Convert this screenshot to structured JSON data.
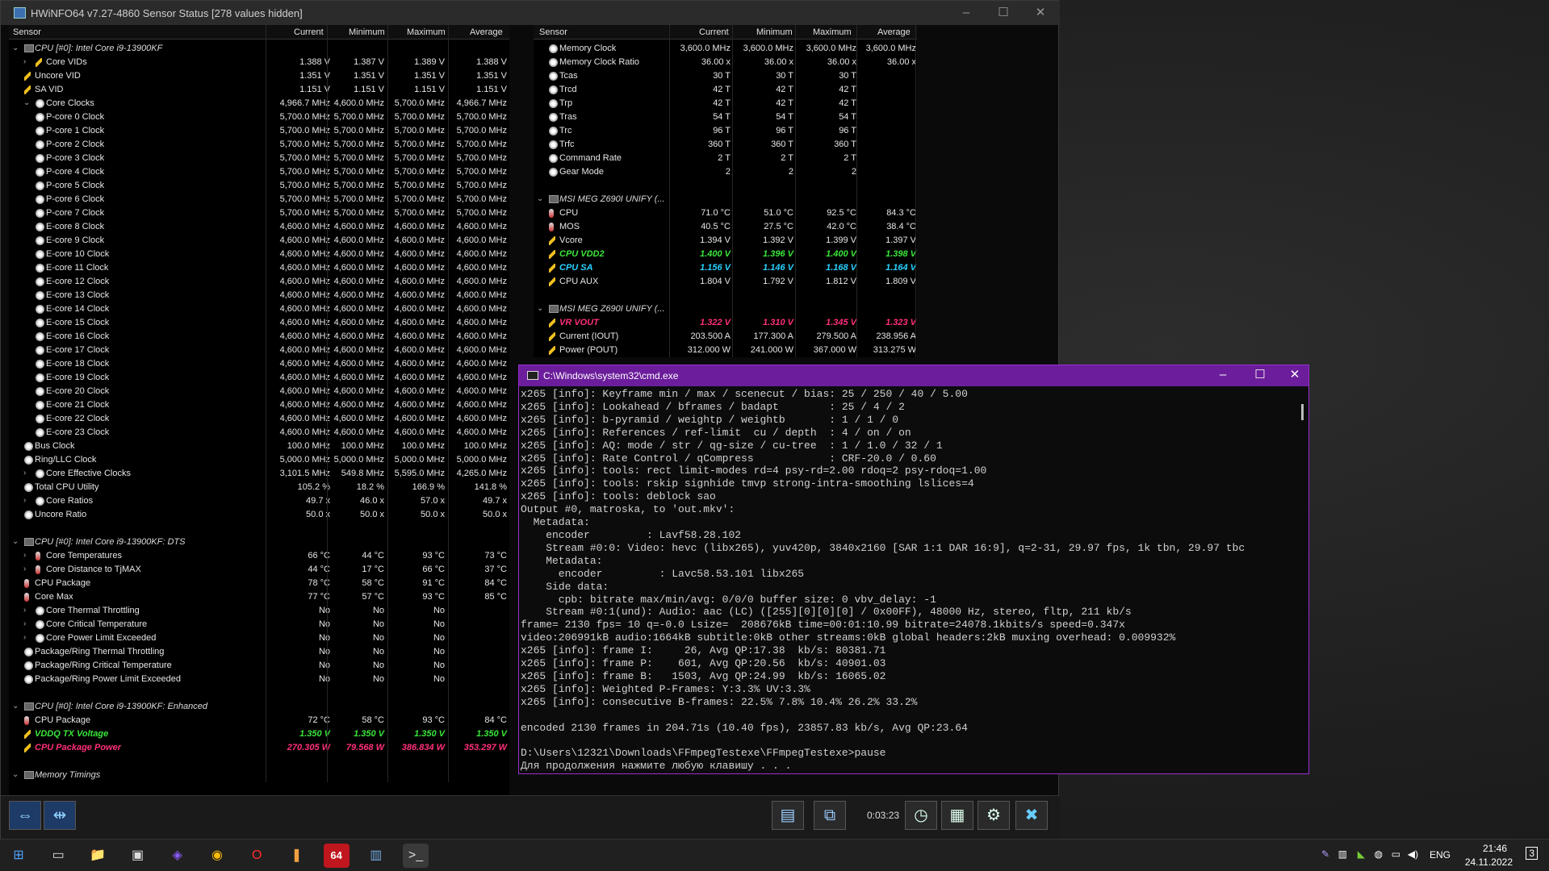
{
  "hwinfo": {
    "title": "HWiNFO64 v7.27-4860 Sensor Status [278 values hidden]",
    "columns": [
      "Sensor",
      "Current",
      "Minimum",
      "Maximum",
      "Average"
    ],
    "left_rows": [
      {
        "t": "grp",
        "exp": "v",
        "name": "CPU [#0]: Intel Core i9-13900KF",
        "cur": "",
        "min": "",
        "max": "",
        "avg": ""
      },
      {
        "t": "volt",
        "exp": ">",
        "lvl": 2,
        "name": "Core VIDs",
        "cur": "1.388 V",
        "min": "1.387 V",
        "max": "1.389 V",
        "avg": "1.388 V"
      },
      {
        "t": "volt",
        "lvl": 1,
        "name": "Uncore VID",
        "cur": "1.351 V",
        "min": "1.351 V",
        "max": "1.351 V",
        "avg": "1.351 V"
      },
      {
        "t": "volt",
        "lvl": 1,
        "name": "SA VID",
        "cur": "1.151 V",
        "min": "1.151 V",
        "max": "1.151 V",
        "avg": "1.151 V"
      },
      {
        "t": "clk",
        "exp": "v",
        "lvl": 2,
        "name": "Core Clocks",
        "cur": "4,966.7 MHz",
        "min": "4,600.0 MHz",
        "max": "5,700.0 MHz",
        "avg": "4,966.7 MHz"
      },
      {
        "t": "clk",
        "lvl": 3,
        "name": "P-core 0 Clock",
        "cur": "5,700.0 MHz",
        "min": "5,700.0 MHz",
        "max": "5,700.0 MHz",
        "avg": "5,700.0 MHz"
      },
      {
        "t": "clk",
        "lvl": 3,
        "name": "P-core 1 Clock",
        "cur": "5,700.0 MHz",
        "min": "5,700.0 MHz",
        "max": "5,700.0 MHz",
        "avg": "5,700.0 MHz"
      },
      {
        "t": "clk",
        "lvl": 3,
        "name": "P-core 2 Clock",
        "cur": "5,700.0 MHz",
        "min": "5,700.0 MHz",
        "max": "5,700.0 MHz",
        "avg": "5,700.0 MHz"
      },
      {
        "t": "clk",
        "lvl": 3,
        "name": "P-core 3 Clock",
        "cur": "5,700.0 MHz",
        "min": "5,700.0 MHz",
        "max": "5,700.0 MHz",
        "avg": "5,700.0 MHz"
      },
      {
        "t": "clk",
        "lvl": 3,
        "name": "P-core 4 Clock",
        "cur": "5,700.0 MHz",
        "min": "5,700.0 MHz",
        "max": "5,700.0 MHz",
        "avg": "5,700.0 MHz"
      },
      {
        "t": "clk",
        "lvl": 3,
        "name": "P-core 5 Clock",
        "cur": "5,700.0 MHz",
        "min": "5,700.0 MHz",
        "max": "5,700.0 MHz",
        "avg": "5,700.0 MHz"
      },
      {
        "t": "clk",
        "lvl": 3,
        "name": "P-core 6 Clock",
        "cur": "5,700.0 MHz",
        "min": "5,700.0 MHz",
        "max": "5,700.0 MHz",
        "avg": "5,700.0 MHz"
      },
      {
        "t": "clk",
        "lvl": 3,
        "name": "P-core 7 Clock",
        "cur": "5,700.0 MHz",
        "min": "5,700.0 MHz",
        "max": "5,700.0 MHz",
        "avg": "5,700.0 MHz"
      },
      {
        "t": "clk",
        "lvl": 3,
        "name": "E-core 8 Clock",
        "cur": "4,600.0 MHz",
        "min": "4,600.0 MHz",
        "max": "4,600.0 MHz",
        "avg": "4,600.0 MHz"
      },
      {
        "t": "clk",
        "lvl": 3,
        "name": "E-core 9 Clock",
        "cur": "4,600.0 MHz",
        "min": "4,600.0 MHz",
        "max": "4,600.0 MHz",
        "avg": "4,600.0 MHz"
      },
      {
        "t": "clk",
        "lvl": 3,
        "name": "E-core 10 Clock",
        "cur": "4,600.0 MHz",
        "min": "4,600.0 MHz",
        "max": "4,600.0 MHz",
        "avg": "4,600.0 MHz"
      },
      {
        "t": "clk",
        "lvl": 3,
        "name": "E-core 11 Clock",
        "cur": "4,600.0 MHz",
        "min": "4,600.0 MHz",
        "max": "4,600.0 MHz",
        "avg": "4,600.0 MHz"
      },
      {
        "t": "clk",
        "lvl": 3,
        "name": "E-core 12 Clock",
        "cur": "4,600.0 MHz",
        "min": "4,600.0 MHz",
        "max": "4,600.0 MHz",
        "avg": "4,600.0 MHz"
      },
      {
        "t": "clk",
        "lvl": 3,
        "name": "E-core 13 Clock",
        "cur": "4,600.0 MHz",
        "min": "4,600.0 MHz",
        "max": "4,600.0 MHz",
        "avg": "4,600.0 MHz"
      },
      {
        "t": "clk",
        "lvl": 3,
        "name": "E-core 14 Clock",
        "cur": "4,600.0 MHz",
        "min": "4,600.0 MHz",
        "max": "4,600.0 MHz",
        "avg": "4,600.0 MHz"
      },
      {
        "t": "clk",
        "lvl": 3,
        "name": "E-core 15 Clock",
        "cur": "4,600.0 MHz",
        "min": "4,600.0 MHz",
        "max": "4,600.0 MHz",
        "avg": "4,600.0 MHz"
      },
      {
        "t": "clk",
        "lvl": 3,
        "name": "E-core 16 Clock",
        "cur": "4,600.0 MHz",
        "min": "4,600.0 MHz",
        "max": "4,600.0 MHz",
        "avg": "4,600.0 MHz"
      },
      {
        "t": "clk",
        "lvl": 3,
        "name": "E-core 17 Clock",
        "cur": "4,600.0 MHz",
        "min": "4,600.0 MHz",
        "max": "4,600.0 MHz",
        "avg": "4,600.0 MHz"
      },
      {
        "t": "clk",
        "lvl": 3,
        "name": "E-core 18 Clock",
        "cur": "4,600.0 MHz",
        "min": "4,600.0 MHz",
        "max": "4,600.0 MHz",
        "avg": "4,600.0 MHz"
      },
      {
        "t": "clk",
        "lvl": 3,
        "name": "E-core 19 Clock",
        "cur": "4,600.0 MHz",
        "min": "4,600.0 MHz",
        "max": "4,600.0 MHz",
        "avg": "4,600.0 MHz"
      },
      {
        "t": "clk",
        "lvl": 3,
        "name": "E-core 20 Clock",
        "cur": "4,600.0 MHz",
        "min": "4,600.0 MHz",
        "max": "4,600.0 MHz",
        "avg": "4,600.0 MHz"
      },
      {
        "t": "clk",
        "lvl": 3,
        "name": "E-core 21 Clock",
        "cur": "4,600.0 MHz",
        "min": "4,600.0 MHz",
        "max": "4,600.0 MHz",
        "avg": "4,600.0 MHz"
      },
      {
        "t": "clk",
        "lvl": 3,
        "name": "E-core 22 Clock",
        "cur": "4,600.0 MHz",
        "min": "4,600.0 MHz",
        "max": "4,600.0 MHz",
        "avg": "4,600.0 MHz"
      },
      {
        "t": "clk",
        "lvl": 3,
        "name": "E-core 23 Clock",
        "cur": "4,600.0 MHz",
        "min": "4,600.0 MHz",
        "max": "4,600.0 MHz",
        "avg": "4,600.0 MHz"
      },
      {
        "t": "clk",
        "lvl": 1,
        "name": "Bus Clock",
        "cur": "100.0 MHz",
        "min": "100.0 MHz",
        "max": "100.0 MHz",
        "avg": "100.0 MHz"
      },
      {
        "t": "clk",
        "lvl": 1,
        "name": "Ring/LLC Clock",
        "cur": "5,000.0 MHz",
        "min": "5,000.0 MHz",
        "max": "5,000.0 MHz",
        "avg": "5,000.0 MHz"
      },
      {
        "t": "clk",
        "exp": ">",
        "lvl": 2,
        "name": "Core Effective Clocks",
        "cur": "3,101.5 MHz",
        "min": "549.8 MHz",
        "max": "5,595.0 MHz",
        "avg": "4,265.0 MHz"
      },
      {
        "t": "clk",
        "lvl": 1,
        "name": "Total CPU Utility",
        "cur": "105.2 %",
        "min": "18.2 %",
        "max": "166.9 %",
        "avg": "141.8 %"
      },
      {
        "t": "clk",
        "exp": ">",
        "lvl": 2,
        "name": "Core Ratios",
        "cur": "49.7 x",
        "min": "46.0 x",
        "max": "57.0 x",
        "avg": "49.7 x"
      },
      {
        "t": "clk",
        "lvl": 1,
        "name": "Uncore Ratio",
        "cur": "50.0 x",
        "min": "50.0 x",
        "max": "50.0 x",
        "avg": "50.0 x"
      },
      {
        "t": "blank"
      },
      {
        "t": "grp",
        "exp": "v",
        "name": "CPU [#0]: Intel Core i9-13900KF: DTS",
        "cur": "",
        "min": "",
        "max": "",
        "avg": ""
      },
      {
        "t": "temp",
        "exp": ">",
        "lvl": 2,
        "name": "Core Temperatures",
        "cur": "66 °C",
        "min": "44 °C",
        "max": "93 °C",
        "avg": "73 °C"
      },
      {
        "t": "temp",
        "exp": ">",
        "lvl": 2,
        "name": "Core Distance to TjMAX",
        "cur": "44 °C",
        "min": "17 °C",
        "max": "66 °C",
        "avg": "37 °C"
      },
      {
        "t": "temp",
        "lvl": 1,
        "name": "CPU Package",
        "cur": "78 °C",
        "min": "58 °C",
        "max": "91 °C",
        "avg": "84 °C"
      },
      {
        "t": "temp",
        "lvl": 1,
        "name": "Core Max",
        "cur": "77 °C",
        "min": "57 °C",
        "max": "93 °C",
        "avg": "85 °C"
      },
      {
        "t": "clk",
        "exp": ">",
        "lvl": 2,
        "name": "Core Thermal Throttling",
        "cur": "No",
        "min": "No",
        "max": "No",
        "avg": ""
      },
      {
        "t": "clk",
        "exp": ">",
        "lvl": 2,
        "name": "Core Critical Temperature",
        "cur": "No",
        "min": "No",
        "max": "No",
        "avg": ""
      },
      {
        "t": "clk",
        "exp": ">",
        "lvl": 2,
        "name": "Core Power Limit Exceeded",
        "cur": "No",
        "min": "No",
        "max": "No",
        "avg": ""
      },
      {
        "t": "clk",
        "lvl": 1,
        "name": "Package/Ring Thermal Throttling",
        "cur": "No",
        "min": "No",
        "max": "No",
        "avg": ""
      },
      {
        "t": "clk",
        "lvl": 1,
        "name": "Package/Ring Critical Temperature",
        "cur": "No",
        "min": "No",
        "max": "No",
        "avg": ""
      },
      {
        "t": "clk",
        "lvl": 1,
        "name": "Package/Ring Power Limit Exceeded",
        "cur": "No",
        "min": "No",
        "max": "No",
        "avg": ""
      },
      {
        "t": "blank"
      },
      {
        "t": "grp",
        "exp": "v",
        "name": "CPU [#0]: Intel Core i9-13900KF: Enhanced",
        "cur": "",
        "min": "",
        "max": "",
        "avg": ""
      },
      {
        "t": "temp",
        "lvl": 1,
        "name": "CPU Package",
        "cur": "72 °C",
        "min": "58 °C",
        "max": "93 °C",
        "avg": "84 °C"
      },
      {
        "t": "volt",
        "lvl": 1,
        "name": "VDDQ TX Voltage",
        "cur": "1.350 V",
        "min": "1.350 V",
        "max": "1.350 V",
        "avg": "1.350 V",
        "hl": "green"
      },
      {
        "t": "volt",
        "lvl": 1,
        "name": "CPU Package Power",
        "cur": "270.305 W",
        "min": "79.568 W",
        "max": "386.834 W",
        "avg": "353.297 W",
        "hl": "pink"
      },
      {
        "t": "blank"
      },
      {
        "t": "grp",
        "exp": "v",
        "name": "Memory Timings",
        "cur": "",
        "min": "",
        "max": "",
        "avg": ""
      }
    ],
    "right_rows": [
      {
        "t": "clk",
        "lvl": 1,
        "name": "Memory Clock",
        "cur": "3,600.0 MHz",
        "min": "3,600.0 MHz",
        "max": "3,600.0 MHz",
        "avg": "3,600.0 MHz"
      },
      {
        "t": "clk",
        "lvl": 1,
        "name": "Memory Clock Ratio",
        "cur": "36.00 x",
        "min": "36.00 x",
        "max": "36.00 x",
        "avg": "36.00 x"
      },
      {
        "t": "clk",
        "lvl": 1,
        "name": "Tcas",
        "cur": "30 T",
        "min": "30 T",
        "max": "30 T",
        "avg": ""
      },
      {
        "t": "clk",
        "lvl": 1,
        "name": "Trcd",
        "cur": "42 T",
        "min": "42 T",
        "max": "42 T",
        "avg": ""
      },
      {
        "t": "clk",
        "lvl": 1,
        "name": "Trp",
        "cur": "42 T",
        "min": "42 T",
        "max": "42 T",
        "avg": ""
      },
      {
        "t": "clk",
        "lvl": 1,
        "name": "Tras",
        "cur": "54 T",
        "min": "54 T",
        "max": "54 T",
        "avg": ""
      },
      {
        "t": "clk",
        "lvl": 1,
        "name": "Trc",
        "cur": "96 T",
        "min": "96 T",
        "max": "96 T",
        "avg": ""
      },
      {
        "t": "clk",
        "lvl": 1,
        "name": "Trfc",
        "cur": "360 T",
        "min": "360 T",
        "max": "360 T",
        "avg": ""
      },
      {
        "t": "clk",
        "lvl": 1,
        "name": "Command Rate",
        "cur": "2 T",
        "min": "2 T",
        "max": "2 T",
        "avg": ""
      },
      {
        "t": "clk",
        "lvl": 1,
        "name": "Gear Mode",
        "cur": "2",
        "min": "2",
        "max": "2",
        "avg": ""
      },
      {
        "t": "blank"
      },
      {
        "t": "grp",
        "exp": "v",
        "name": "MSI MEG Z690I UNIFY (...",
        "cur": "",
        "min": "",
        "max": "",
        "avg": ""
      },
      {
        "t": "temp",
        "lvl": 1,
        "name": "CPU",
        "cur": "71.0 °C",
        "min": "51.0 °C",
        "max": "92.5 °C",
        "avg": "84.3 °C"
      },
      {
        "t": "temp",
        "lvl": 1,
        "name": "MOS",
        "cur": "40.5 °C",
        "min": "27.5 °C",
        "max": "42.0 °C",
        "avg": "38.4 °C"
      },
      {
        "t": "volt",
        "lvl": 1,
        "name": "Vcore",
        "cur": "1.394 V",
        "min": "1.392 V",
        "max": "1.399 V",
        "avg": "1.397 V"
      },
      {
        "t": "volt",
        "lvl": 1,
        "name": "CPU VDD2",
        "cur": "1.400 V",
        "min": "1.396 V",
        "max": "1.400 V",
        "avg": "1.398 V",
        "hl": "green"
      },
      {
        "t": "volt",
        "lvl": 1,
        "name": "CPU SA",
        "cur": "1.156 V",
        "min": "1.146 V",
        "max": "1.168 V",
        "avg": "1.164 V",
        "hl": "cyan"
      },
      {
        "t": "volt",
        "lvl": 1,
        "name": "CPU AUX",
        "cur": "1.804 V",
        "min": "1.792 V",
        "max": "1.812 V",
        "avg": "1.809 V"
      },
      {
        "t": "blank"
      },
      {
        "t": "grp",
        "exp": "v",
        "name": "MSI MEG Z690I UNIFY (...",
        "cur": "",
        "min": "",
        "max": "",
        "avg": ""
      },
      {
        "t": "volt",
        "lvl": 1,
        "name": "VR VOUT",
        "cur": "1.322 V",
        "min": "1.310 V",
        "max": "1.345 V",
        "avg": "1.323 V",
        "hl": "pink"
      },
      {
        "t": "volt",
        "lvl": 1,
        "name": "Current (IOUT)",
        "cur": "203.500 A",
        "min": "177.300 A",
        "max": "279.500 A",
        "avg": "238.956 A"
      },
      {
        "t": "volt",
        "lvl": 1,
        "name": "Power (POUT)",
        "cur": "312.000 W",
        "min": "241.000 W",
        "max": "367.000 W",
        "avg": "313.275 W"
      }
    ],
    "timer": "0:03:23"
  },
  "cmd": {
    "title": "C:\\Windows\\system32\\cmd.exe",
    "lines": [
      "x265 [info]: Keyframe min / max / scenecut / bias: 25 / 250 / 40 / 5.00",
      "x265 [info]: Lookahead / bframes / badapt        : 25 / 4 / 2",
      "x265 [info]: b-pyramid / weightp / weightb       : 1 / 1 / 0",
      "x265 [info]: References / ref-limit  cu / depth  : 4 / on / on",
      "x265 [info]: AQ: mode / str / qg-size / cu-tree  : 1 / 1.0 / 32 / 1",
      "x265 [info]: Rate Control / qCompress            : CRF-20.0 / 0.60",
      "x265 [info]: tools: rect limit-modes rd=4 psy-rd=2.00 rdoq=2 psy-rdoq=1.00",
      "x265 [info]: tools: rskip signhide tmvp strong-intra-smoothing lslices=4",
      "x265 [info]: tools: deblock sao",
      "Output #0, matroska, to 'out.mkv':",
      "  Metadata:",
      "    encoder         : Lavf58.28.102",
      "    Stream #0:0: Video: hevc (libx265), yuv420p, 3840x2160 [SAR 1:1 DAR 16:9], q=2-31, 29.97 fps, 1k tbn, 29.97 tbc",
      "    Metadata:",
      "      encoder         : Lavc58.53.101 libx265",
      "    Side data:",
      "      cpb: bitrate max/min/avg: 0/0/0 buffer size: 0 vbv_delay: -1",
      "    Stream #0:1(und): Audio: aac (LC) ([255][0][0][0] / 0x00FF), 48000 Hz, stereo, fltp, 211 kb/s",
      "frame= 2130 fps= 10 q=-0.0 Lsize=  208676kB time=00:01:10.99 bitrate=24078.1kbits/s speed=0.347x",
      "video:206991kB audio:1664kB subtitle:0kB other streams:0kB global headers:2kB muxing overhead: 0.009932%",
      "x265 [info]: frame I:     26, Avg QP:17.38  kb/s: 80381.71",
      "x265 [info]: frame P:    601, Avg QP:20.56  kb/s: 40901.03",
      "x265 [info]: frame B:   1503, Avg QP:24.99  kb/s: 16065.02",
      "x265 [info]: Weighted P-Frames: Y:3.3% UV:3.3%",
      "x265 [info]: consecutive B-frames: 22.5% 7.8% 10.4% 26.2% 33.2%",
      "",
      "encoded 2130 frames in 204.71s (10.40 fps), 23857.83 kb/s, Avg QP:23.64",
      "",
      "D:\\Users\\12321\\Downloads\\FFmpegTestexe\\FFmpegTestexe>pause",
      "Для продолжения нажмите любую клавишу . . ."
    ]
  },
  "taskbar": {
    "items": [
      {
        "name": "start-icon",
        "glyph": "⊞"
      },
      {
        "name": "task-view-icon",
        "glyph": "▭"
      },
      {
        "name": "file-explorer-icon",
        "glyph": "📁"
      },
      {
        "name": "app-monitor-icon",
        "glyph": "▣"
      },
      {
        "name": "app-purple-icon",
        "glyph": "◈"
      },
      {
        "name": "chrome-icon",
        "glyph": "◉"
      },
      {
        "name": "opera-icon",
        "glyph": "O"
      },
      {
        "name": "app-tool-icon",
        "glyph": "❚"
      },
      {
        "name": "aida64-icon",
        "glyph": "64"
      },
      {
        "name": "hwinfo-taskbar-icon",
        "glyph": "▥"
      },
      {
        "name": "cmd-taskbar-icon",
        "glyph": ">_"
      }
    ],
    "lang": "ENG",
    "time": "21:46",
    "date": "24.11.2022",
    "notif": "3"
  },
  "colors": {
    "green": "#39e639",
    "cyan": "#28d2ff",
    "pink": "#ff2f7a",
    "cmd_accent": "#6b1d9b"
  }
}
